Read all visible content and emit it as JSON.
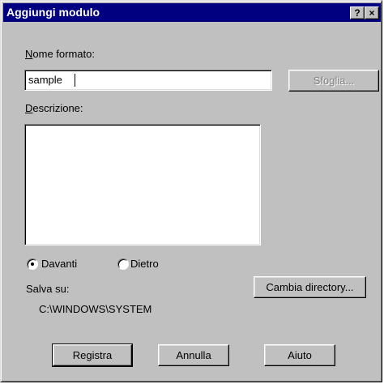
{
  "window": {
    "title": "Aggiungi modulo",
    "help_button": "?",
    "close_button": "×"
  },
  "name_field": {
    "label": "Nome formato:",
    "value": "sample"
  },
  "browse_button": "Sfoglia...",
  "description": {
    "label": "Descrizione:",
    "value": ""
  },
  "position": {
    "options": [
      {
        "label": "Davanti",
        "selected": true
      },
      {
        "label": "Dietro",
        "selected": false
      }
    ]
  },
  "save_location": {
    "label": "Salva su:",
    "path": "C:\\WINDOWS\\SYSTEM"
  },
  "change_dir_button": "Cambia directory...",
  "footer": {
    "register_button": "Registra",
    "cancel_button": "Annulla",
    "help_button": "Aiuto"
  }
}
